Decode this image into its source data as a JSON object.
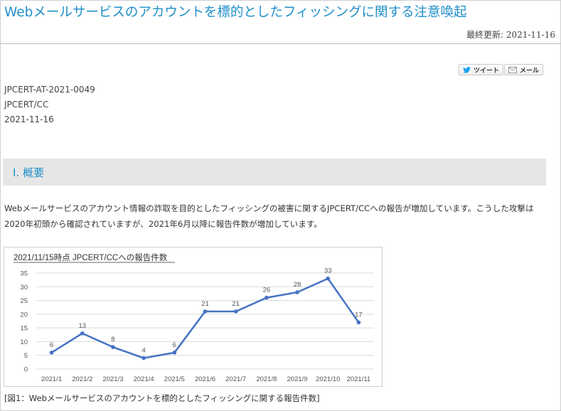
{
  "page": {
    "title": "Webメールサービスのアカウントを標的としたフィッシングに関する注意喚起",
    "last_updated_label": "最終更新:",
    "last_updated_value": "2021-11-16"
  },
  "share": {
    "tweet_label": "ツイート",
    "mail_label": "メール"
  },
  "meta": {
    "id": "JPCERT-AT-2021-0049",
    "org": "JPCERT/CC",
    "date": "2021-11-16"
  },
  "section": {
    "title": "I. 概要"
  },
  "overview": {
    "text": "Webメールサービスのアカウント情報の詐取を目的としたフィッシングの被害に関するJPCERT/CCへの報告が増加しています。こうした攻撃は2020年初頭から確認されていますが、2021年6月以降に報告件数が増加しています。"
  },
  "figure": {
    "caption": "[図1：Webメールサービスのアカウントを標的としたフィッシングに関する報告件数]"
  },
  "colors": {
    "accent": "#1f8fc9",
    "series": "#4472c4",
    "grid": "#d9d9d9"
  },
  "chart_data": {
    "type": "line",
    "title": "2021/11/15時点 JPCERT/CCへの報告件数",
    "xlabel": "",
    "ylabel": "",
    "categories": [
      "2021/1",
      "2021/2",
      "2021/3",
      "2021/4",
      "2021/5",
      "2021/6",
      "2021/7",
      "2021/8",
      "2021/9",
      "2021/10",
      "2021/11"
    ],
    "series": [
      {
        "values": [
          6,
          13,
          8,
          4,
          6,
          21,
          21,
          26,
          28,
          33,
          17
        ]
      }
    ],
    "ylim": [
      0,
      35
    ],
    "yticks": [
      0,
      5,
      10,
      15,
      20,
      25,
      30,
      35
    ],
    "grid": true,
    "data_labels": true
  }
}
